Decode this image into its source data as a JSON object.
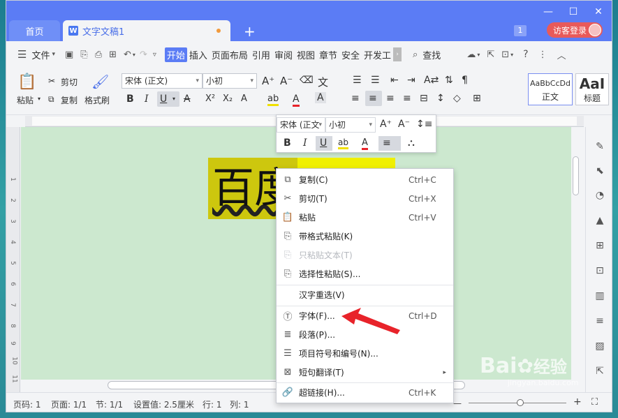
{
  "tabs": {
    "home": "首页",
    "doc": "文字文稿1",
    "doc_badge": "W",
    "add": "+"
  },
  "titlebar": {
    "tab_count": "1",
    "login": "访客登录"
  },
  "menubar": {
    "file": "文件",
    "items": [
      "开始",
      "插入",
      "页面布局",
      "引用",
      "审阅",
      "视图",
      "章节",
      "安全",
      "开发工"
    ],
    "search": "查找"
  },
  "ribbon": {
    "paste": "粘贴",
    "cut": "剪切",
    "copy": "复制",
    "format_painter": "格式刷",
    "font_name": "宋体 (正文)",
    "font_size": "小初",
    "style_normal_preview": "AaBbCcDd",
    "style_normal": "正文",
    "style_heading_preview": "AaI",
    "style_heading": "标题"
  },
  "document": {
    "selected_text": "百度"
  },
  "minibar": {
    "font_name": "宋体 (正文",
    "font_size": "小初"
  },
  "context_menu": {
    "items": [
      {
        "icon": "copy-icon",
        "label": "复制(C)",
        "shortcut": "Ctrl+C"
      },
      {
        "icon": "scissors-icon",
        "label": "剪切(T)",
        "shortcut": "Ctrl+X"
      },
      {
        "icon": "clipboard-icon",
        "label": "粘贴",
        "shortcut": "Ctrl+V"
      },
      {
        "icon": "paste-format-icon",
        "label": "带格式粘贴(K)",
        "shortcut": ""
      },
      {
        "icon": "paste-text-icon",
        "label": "只粘贴文本(T)",
        "shortcut": ""
      },
      {
        "icon": "paste-special-icon",
        "label": "选择性粘贴(S)...",
        "shortcut": ""
      },
      {
        "icon": "",
        "label": "汉字重选(V)",
        "shortcut": ""
      },
      {
        "icon": "font-icon",
        "label": "字体(F)...",
        "shortcut": "Ctrl+D"
      },
      {
        "icon": "paragraph-icon",
        "label": "段落(P)...",
        "shortcut": ""
      },
      {
        "icon": "bullets-icon",
        "label": "项目符号和编号(N)...",
        "shortcut": ""
      },
      {
        "icon": "translate-icon",
        "label": "短句翻译(T)",
        "shortcut": ""
      },
      {
        "icon": "link-icon",
        "label": "超链接(H)...",
        "shortcut": "Ctrl+K"
      }
    ]
  },
  "statusbar": {
    "page_num": "页码: 1",
    "pages": "页面: 1/1",
    "section": "节: 1/1",
    "setting": "设置值: 2.5厘米",
    "row": "行: 1",
    "col": "列: 1"
  },
  "watermark": {
    "brand": "Bai",
    "brand_cn": "经验",
    "url": "jingyan.baidu.com"
  },
  "colors": {
    "accent": "#5b7cf5",
    "doc_bg": "#cce8cf",
    "highlight_olive": "#cdc70e",
    "highlight_yellow": "#f0f000",
    "arrow_red": "#e8232a"
  }
}
